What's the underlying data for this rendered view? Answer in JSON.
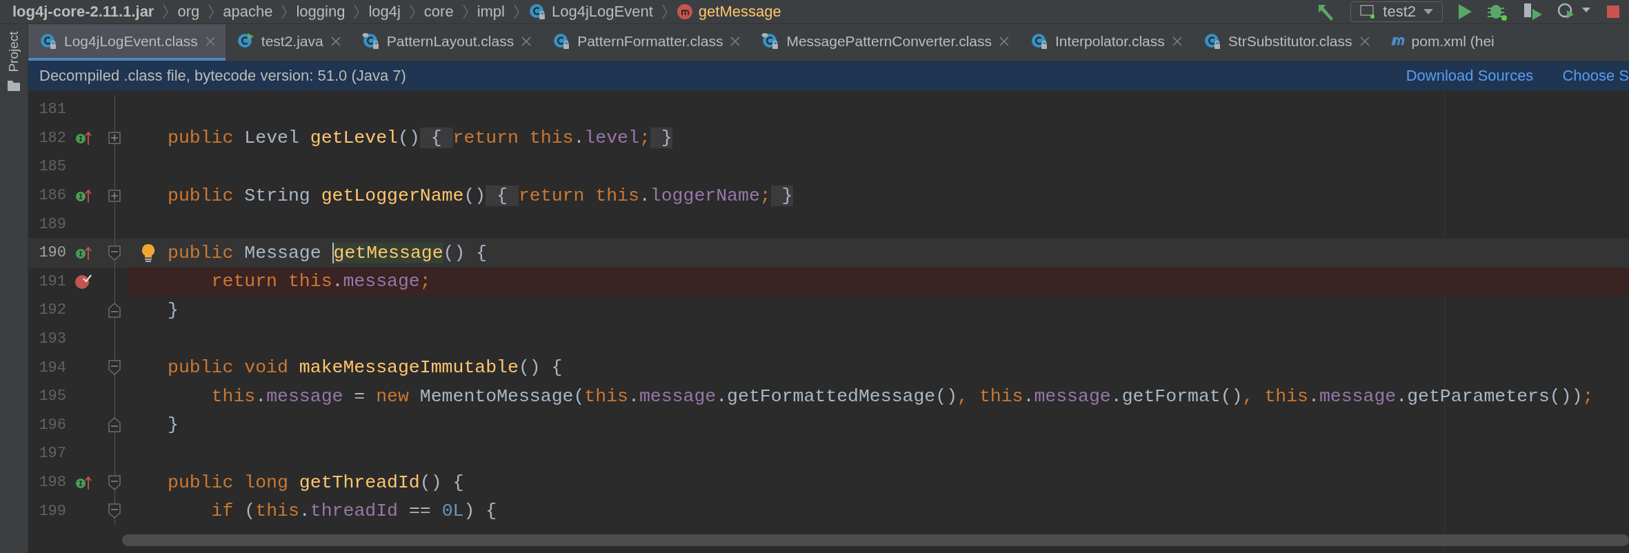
{
  "breadcrumbs": [
    {
      "kind": "jar",
      "label": "log4j-core-2.11.1.jar"
    },
    {
      "kind": "package",
      "label": "org"
    },
    {
      "kind": "package",
      "label": "apache"
    },
    {
      "kind": "package",
      "label": "logging"
    },
    {
      "kind": "package",
      "label": "log4j"
    },
    {
      "kind": "package",
      "label": "core"
    },
    {
      "kind": "package",
      "label": "impl"
    },
    {
      "kind": "class",
      "label": "Log4jLogEvent"
    },
    {
      "kind": "method",
      "label": "getMessage"
    }
  ],
  "run_config": {
    "label": "test2"
  },
  "side_panel": {
    "label": "Project"
  },
  "tabs": [
    {
      "kind": "class",
      "label": "Log4jLogEvent.class",
      "selected": true,
      "closable": true
    },
    {
      "kind": "java-run",
      "label": "test2.java",
      "selected": false,
      "closable": true
    },
    {
      "kind": "class-marked",
      "label": "PatternLayout.class",
      "selected": false,
      "closable": true
    },
    {
      "kind": "class",
      "label": "PatternFormatter.class",
      "selected": false,
      "closable": true
    },
    {
      "kind": "class-marked",
      "label": "MessagePatternConverter.class",
      "selected": false,
      "closable": true
    },
    {
      "kind": "class",
      "label": "Interpolator.class",
      "selected": false,
      "closable": true
    },
    {
      "kind": "class",
      "label": "StrSubstitutor.class",
      "selected": false,
      "closable": true
    },
    {
      "kind": "maven",
      "label": "pom.xml (hei",
      "selected": false,
      "closable": false
    }
  ],
  "banner": {
    "message": "Decompiled .class file, bytecode version: 51.0 (Java 7)",
    "links": [
      "Download Sources",
      "Choose S"
    ]
  },
  "editor": {
    "lines": [
      {
        "number": "181",
        "current": false,
        "breakpoint": false,
        "bulb": false
      },
      {
        "number": "182",
        "marker": {
          "kind": "override"
        },
        "fold": {
          "kind": "collapsed"
        },
        "current": false,
        "breakpoint": false,
        "bulb": false,
        "tokens": [
          {
            "kind": "keyword",
            "text": "public "
          },
          {
            "kind": "plain",
            "text": "Level "
          },
          {
            "kind": "method",
            "text": "getLevel"
          },
          {
            "kind": "plain",
            "text": "()"
          },
          {
            "kind": "folded",
            "text": " { "
          },
          {
            "kind": "keyword",
            "text": "return this"
          },
          {
            "kind": "plain",
            "text": "."
          },
          {
            "kind": "field",
            "text": "level"
          },
          {
            "kind": "keyword",
            "text": ";"
          },
          {
            "kind": "folded",
            "text": " }"
          }
        ]
      },
      {
        "number": "185",
        "current": false,
        "breakpoint": false,
        "bulb": false
      },
      {
        "number": "186",
        "marker": {
          "kind": "override"
        },
        "fold": {
          "kind": "collapsed"
        },
        "current": false,
        "breakpoint": false,
        "bulb": false,
        "tokens": [
          {
            "kind": "keyword",
            "text": "public "
          },
          {
            "kind": "plain",
            "text": "String "
          },
          {
            "kind": "method",
            "text": "getLoggerName"
          },
          {
            "kind": "plain",
            "text": "()"
          },
          {
            "kind": "folded",
            "text": " { "
          },
          {
            "kind": "keyword",
            "text": "return this"
          },
          {
            "kind": "plain",
            "text": "."
          },
          {
            "kind": "field",
            "text": "loggerName"
          },
          {
            "kind": "keyword",
            "text": ";"
          },
          {
            "kind": "folded",
            "text": " }"
          }
        ]
      },
      {
        "number": "189",
        "current": false,
        "breakpoint": false,
        "bulb": false
      },
      {
        "number": "190",
        "marker": {
          "kind": "override"
        },
        "fold": {
          "kind": "open"
        },
        "current": true,
        "breakpoint": false,
        "bulb": true,
        "tokens": [
          {
            "kind": "keyword",
            "text": "public "
          },
          {
            "kind": "plain",
            "text": "Message "
          },
          {
            "kind": "method-highlight",
            "text": "getMessage"
          },
          {
            "kind": "plain",
            "text": "() {"
          }
        ]
      },
      {
        "number": "191",
        "marker": {
          "kind": "breakpoint"
        },
        "current": false,
        "breakpoint": true,
        "bulb": false,
        "tokens": [
          {
            "kind": "keyword",
            "text": "    return this"
          },
          {
            "kind": "plain",
            "text": "."
          },
          {
            "kind": "field",
            "text": "message"
          },
          {
            "kind": "keyword",
            "text": ";"
          }
        ]
      },
      {
        "number": "192",
        "fold": {
          "kind": "end"
        },
        "current": false,
        "breakpoint": false,
        "bulb": false,
        "tokens": [
          {
            "kind": "plain",
            "text": "}"
          }
        ]
      },
      {
        "number": "193",
        "current": false,
        "breakpoint": false,
        "bulb": false
      },
      {
        "number": "194",
        "fold": {
          "kind": "open"
        },
        "current": false,
        "breakpoint": false,
        "bulb": false,
        "tokens": [
          {
            "kind": "keyword",
            "text": "public void "
          },
          {
            "kind": "method",
            "text": "makeMessageImmutable"
          },
          {
            "kind": "plain",
            "text": "() {"
          }
        ]
      },
      {
        "number": "195",
        "current": false,
        "breakpoint": false,
        "bulb": false,
        "tokens": [
          {
            "kind": "keyword",
            "text": "    this"
          },
          {
            "kind": "plain",
            "text": "."
          },
          {
            "kind": "field",
            "text": "message"
          },
          {
            "kind": "plain",
            "text": " = "
          },
          {
            "kind": "keyword",
            "text": "new "
          },
          {
            "kind": "plain",
            "text": "MementoMessage("
          },
          {
            "kind": "keyword",
            "text": "this"
          },
          {
            "kind": "plain",
            "text": "."
          },
          {
            "kind": "field",
            "text": "message"
          },
          {
            "kind": "plain",
            "text": ".getFormattedMessage()"
          },
          {
            "kind": "keyword",
            "text": ", this"
          },
          {
            "kind": "plain",
            "text": "."
          },
          {
            "kind": "field",
            "text": "message"
          },
          {
            "kind": "plain",
            "text": ".getFormat()"
          },
          {
            "kind": "keyword",
            "text": ", this"
          },
          {
            "kind": "plain",
            "text": "."
          },
          {
            "kind": "field",
            "text": "message"
          },
          {
            "kind": "plain",
            "text": ".getParameters())"
          },
          {
            "kind": "keyword",
            "text": ";"
          }
        ]
      },
      {
        "number": "196",
        "fold": {
          "kind": "end"
        },
        "current": false,
        "breakpoint": false,
        "bulb": false,
        "tokens": [
          {
            "kind": "plain",
            "text": "}"
          }
        ]
      },
      {
        "number": "197",
        "current": false,
        "breakpoint": false,
        "bulb": false
      },
      {
        "number": "198",
        "marker": {
          "kind": "override"
        },
        "fold": {
          "kind": "open"
        },
        "current": false,
        "breakpoint": false,
        "bulb": false,
        "tokens": [
          {
            "kind": "keyword",
            "text": "public long "
          },
          {
            "kind": "method",
            "text": "getThreadId"
          },
          {
            "kind": "plain",
            "text": "() {"
          }
        ]
      },
      {
        "number": "199",
        "fold": {
          "kind": "open"
        },
        "current": false,
        "breakpoint": false,
        "bulb": false,
        "tokens": [
          {
            "kind": "keyword",
            "text": "    if "
          },
          {
            "kind": "plain",
            "text": "("
          },
          {
            "kind": "keyword",
            "text": "this"
          },
          {
            "kind": "plain",
            "text": "."
          },
          {
            "kind": "field",
            "text": "threadId"
          },
          {
            "kind": "plain",
            "text": " == "
          },
          {
            "kind": "number",
            "text": "0L"
          },
          {
            "kind": "plain",
            "text": ") {"
          }
        ]
      }
    ]
  }
}
